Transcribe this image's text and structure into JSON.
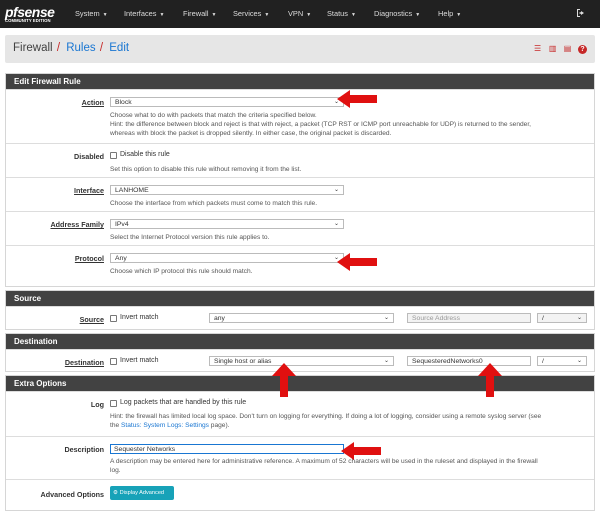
{
  "navbar": {
    "logo_word": "pfsense",
    "logo_edition": "COMMUNITY EDITION",
    "items": [
      {
        "label": "System"
      },
      {
        "label": "Interfaces"
      },
      {
        "label": "Firewall"
      },
      {
        "label": "Services"
      },
      {
        "label": "VPN"
      },
      {
        "label": "Status"
      },
      {
        "label": "Diagnostics"
      },
      {
        "label": "Help"
      }
    ],
    "logout_icon": "sign-out-icon"
  },
  "breadcrumb": {
    "part1": "Firewall",
    "sep1": "/",
    "part2": "Rules",
    "sep2": "/",
    "part3": "Edit",
    "icons": [
      "sliders-icon",
      "bar-chart-icon",
      "list-icon",
      "help-icon"
    ]
  },
  "edit_rule": {
    "heading": "Edit Firewall Rule",
    "action": {
      "label": "Action",
      "value": "Block",
      "help1": "Choose what to do with packets that match the criteria specified below.",
      "help2": "Hint: the difference between block and reject is that with reject, a packet (TCP RST or ICMP port unreachable for UDP) is returned to the sender,",
      "help3": "whereas with block the packet is dropped silently. In either case, the original packet is discarded."
    },
    "disabled": {
      "label": "Disabled",
      "check_label": "Disable this rule",
      "help": "Set this option to disable this rule without removing it from the list."
    },
    "interface": {
      "label": "Interface",
      "value": "LANHOME",
      "help": "Choose the interface from which packets must come to match this rule."
    },
    "address_family": {
      "label": "Address Family",
      "value": "IPv4",
      "help": "Select the Internet Protocol version this rule applies to."
    },
    "protocol": {
      "label": "Protocol",
      "value": "Any",
      "help": "Choose which IP protocol this rule should match."
    }
  },
  "source": {
    "heading": "Source",
    "label": "Source",
    "invert_label": "Invert match",
    "type_value": "any",
    "address_placeholder": "Source Address",
    "slash": "/"
  },
  "destination": {
    "heading": "Destination",
    "label": "Destination",
    "invert_label": "Invert match",
    "type_value": "Single host or alias",
    "address_value": "SequesteredNetworks0",
    "slash": "/"
  },
  "extra": {
    "heading": "Extra Options",
    "log": {
      "label": "Log",
      "check_label": "Log packets that are handled by this rule",
      "help1": "Hint: the firewall has limited local log space. Don't turn on logging for everything. If doing a lot of logging, consider using a remote syslog server (see",
      "help2_pre": "the ",
      "help2_link": "Status: System Logs: Settings",
      "help2_post": " page)."
    },
    "description": {
      "label": "Description",
      "value": "Sequester Networks",
      "help1": "A description may be entered here for administrative reference. A maximum of 52 characters will be used in the ruleset and displayed in the firewall",
      "help2": "log."
    },
    "advanced": {
      "label": "Advanced Options",
      "button": "Display Advanced",
      "button_icon": "gear-icon"
    }
  },
  "colors": {
    "navbar": "#212121",
    "panel_heading": "#424242",
    "accent_red": "#c62828",
    "link_blue": "#1976d2",
    "button_teal": "#17a2b8",
    "arrow_red": "#e01010"
  }
}
